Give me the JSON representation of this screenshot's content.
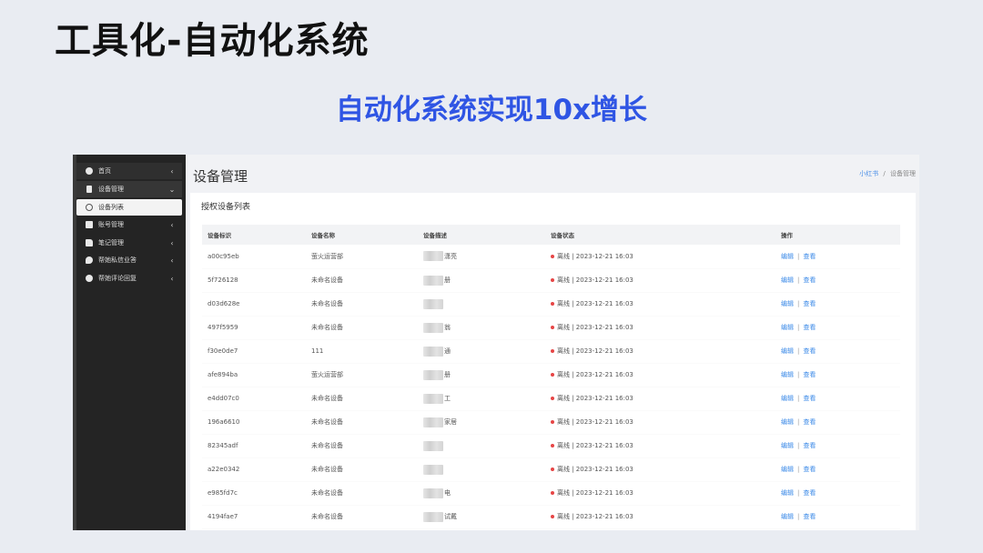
{
  "slide": {
    "title": "工具化-自动化系统",
    "subtitle": "自动化系统实现10x增长"
  },
  "sidebar": {
    "items": [
      {
        "label": "首页",
        "arrow": "‹"
      },
      {
        "label": "设备管理",
        "arrow": "⌄"
      },
      {
        "label": "设备列表"
      },
      {
        "label": "账号管理",
        "arrow": "‹"
      },
      {
        "label": "笔记管理",
        "arrow": "‹"
      },
      {
        "label": "帮她私信业答",
        "arrow": "‹"
      },
      {
        "label": "帮她评论回复",
        "arrow": "‹"
      }
    ]
  },
  "header": {
    "title": "设备管理",
    "breadcrumb": {
      "home": "小红书",
      "separator": "/",
      "current": "设备管理"
    }
  },
  "card": {
    "title": "授权设备列表"
  },
  "table": {
    "columns": [
      "设备标识",
      "设备名称",
      "设备描述",
      "设备状态",
      "操作"
    ],
    "rows": [
      {
        "id": "a00c95eb",
        "name": "萤火运营部",
        "desc": "潇亮",
        "status": "离线 | 2023-12-21 16:03",
        "edit": "编辑",
        "sep": "|",
        "view": "查看"
      },
      {
        "id": "5f726128",
        "name": "未命名设备",
        "desc": "册",
        "status": "离线 | 2023-12-21 16:03",
        "edit": "编辑",
        "sep": "|",
        "view": "查看"
      },
      {
        "id": "d03d628e",
        "name": "未命名设备",
        "desc": "",
        "status": "离线 | 2023-12-21 16:03",
        "edit": "编辑",
        "sep": "|",
        "view": "查看"
      },
      {
        "id": "497f5959",
        "name": "未命名设备",
        "desc": "翁",
        "status": "离线 | 2023-12-21 16:03",
        "edit": "编辑",
        "sep": "|",
        "view": "查看"
      },
      {
        "id": "f30e0de7",
        "name": "111",
        "desc": "通",
        "status": "离线 | 2023-12-21 16:03",
        "edit": "编辑",
        "sep": "|",
        "view": "查看"
      },
      {
        "id": "afe894ba",
        "name": "萤火运营部",
        "desc": "册",
        "status": "离线 | 2023-12-21 16:03",
        "edit": "编辑",
        "sep": "|",
        "view": "查看"
      },
      {
        "id": "e4dd07c0",
        "name": "未命名设备",
        "desc": "工",
        "status": "离线 | 2023-12-21 16:03",
        "edit": "编辑",
        "sep": "|",
        "view": "查看"
      },
      {
        "id": "196a6610",
        "name": "未命名设备",
        "desc": "家居",
        "status": "离线 | 2023-12-21 16:03",
        "edit": "编辑",
        "sep": "|",
        "view": "查看"
      },
      {
        "id": "82345adf",
        "name": "未命名设备",
        "desc": "",
        "status": "离线 | 2023-12-21 16:03",
        "edit": "编辑",
        "sep": "|",
        "view": "查看"
      },
      {
        "id": "a22e0342",
        "name": "未命名设备",
        "desc": "",
        "status": "离线 | 2023-12-21 16:03",
        "edit": "编辑",
        "sep": "|",
        "view": "查看"
      },
      {
        "id": "e985fd7c",
        "name": "未命名设备",
        "desc": "电",
        "status": "离线 | 2023-12-21 16:03",
        "edit": "编辑",
        "sep": "|",
        "view": "查看"
      },
      {
        "id": "4194fae7",
        "name": "未命名设备",
        "desc": "试戴",
        "status": "离线 | 2023-12-21 16:03",
        "edit": "编辑",
        "sep": "|",
        "view": "查看"
      }
    ]
  },
  "colors": {
    "accent": "#2f55e4",
    "link": "#3d8be8",
    "status_offline": "#e64545",
    "sidebar_bg": "#242424"
  }
}
